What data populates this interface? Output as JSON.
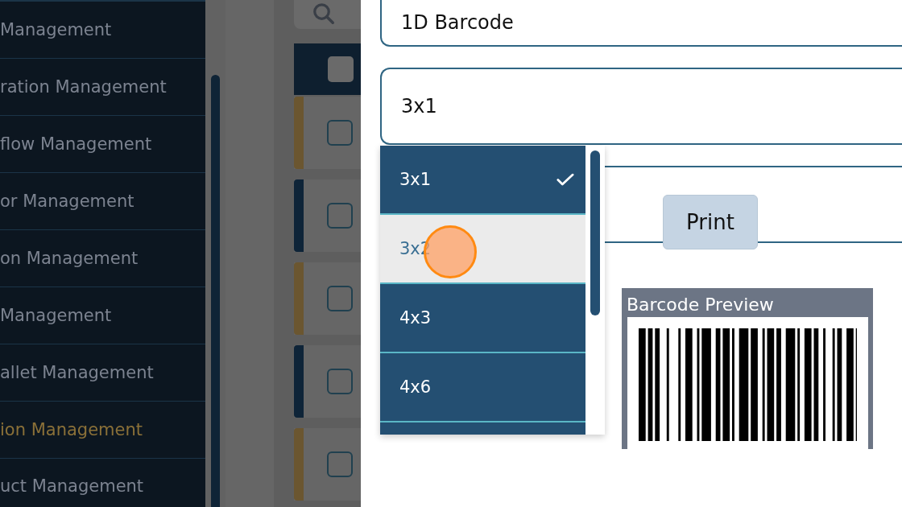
{
  "sidebar": {
    "items": [
      {
        "label": "Management",
        "selected": false
      },
      {
        "label": "ration Management",
        "selected": false
      },
      {
        "label": "flow Management",
        "selected": false
      },
      {
        "label": "or Management",
        "selected": false
      },
      {
        "label": "on Management",
        "selected": false
      },
      {
        "label": "Management",
        "selected": false
      },
      {
        "label": "allet Management",
        "selected": false
      },
      {
        "label": "ion Management",
        "selected": true
      },
      {
        "label": "uct Management",
        "selected": false
      }
    ]
  },
  "table": {
    "header_checked": false,
    "rows": [
      {
        "color": "#6b5630",
        "checked": false
      },
      {
        "color": "#0e2438",
        "checked": false
      },
      {
        "color": "#6b5630",
        "checked": false
      },
      {
        "color": "#0e2438",
        "checked": false
      },
      {
        "color": "#6b5630",
        "checked": false
      }
    ]
  },
  "form": {
    "fields": [
      {
        "value": "1D Barcode"
      },
      {
        "value": "3x1"
      }
    ],
    "dropdown": {
      "options": [
        {
          "label": "3x1",
          "selected": true,
          "hovered": false
        },
        {
          "label": "3x2",
          "selected": false,
          "hovered": true
        },
        {
          "label": "4x3",
          "selected": false,
          "hovered": false
        },
        {
          "label": "4x6",
          "selected": false,
          "hovered": false
        }
      ]
    },
    "print_button": "Print",
    "preview": {
      "title": "Barcode Preview"
    }
  }
}
